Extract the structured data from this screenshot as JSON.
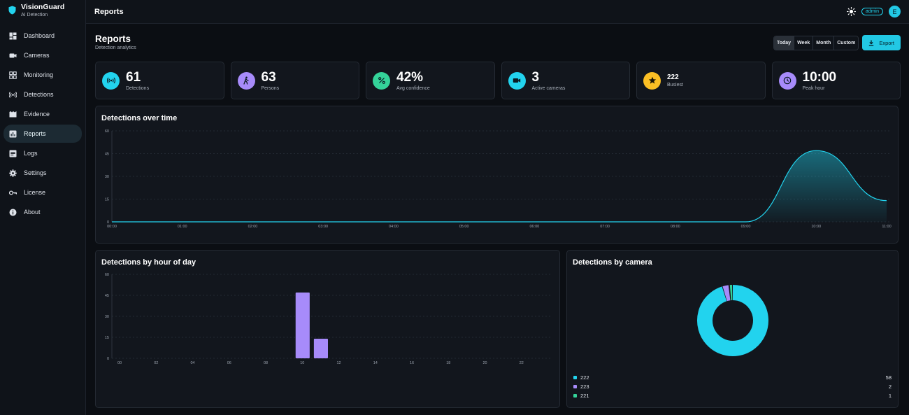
{
  "brand": {
    "name": "VisionGuard",
    "subtitle": "AI Detection"
  },
  "sidebar": {
    "items": [
      {
        "label": "Dashboard",
        "icon": "dashboard-icon"
      },
      {
        "label": "Cameras",
        "icon": "camera-icon"
      },
      {
        "label": "Monitoring",
        "icon": "grid-icon"
      },
      {
        "label": "Detections",
        "icon": "broadcast-icon"
      },
      {
        "label": "Evidence",
        "icon": "film-icon"
      },
      {
        "label": "Reports",
        "icon": "bar-chart-icon",
        "active": true
      },
      {
        "label": "Logs",
        "icon": "document-icon"
      },
      {
        "label": "Settings",
        "icon": "gear-icon"
      },
      {
        "label": "License",
        "icon": "key-icon"
      },
      {
        "label": "About",
        "icon": "info-icon"
      }
    ]
  },
  "topbar": {
    "title": "Reports",
    "role_badge": "admin",
    "avatar_letter": "E",
    "theme_icon": "sun-icon"
  },
  "page": {
    "title": "Reports",
    "subtitle": "Detection analytics"
  },
  "range": {
    "options": [
      "Today",
      "Week",
      "Month",
      "Custom"
    ],
    "selected": "Today"
  },
  "export_label": "Export",
  "stats": [
    {
      "value": "61",
      "label": "Detections",
      "icon": "broadcast-icon",
      "color": "#22d3ee"
    },
    {
      "value": "63",
      "label": "Persons",
      "icon": "person-walking-icon",
      "color": "#a78bfa"
    },
    {
      "value": "42%",
      "label": "Avg confidence",
      "icon": "percent-icon",
      "color": "#34d399"
    },
    {
      "value": "3",
      "label": "Active cameras",
      "icon": "video-icon",
      "color": "#22d3ee"
    },
    {
      "value": "222",
      "label": "Busiest",
      "icon": "star-icon",
      "color": "#fbbf24"
    },
    {
      "value": "10:00",
      "label": "Peak hour",
      "icon": "clock-icon",
      "color": "#a78bfa"
    }
  ],
  "colors": {
    "accent": "#22d3ee",
    "purple": "#a78bfa",
    "green": "#34d399",
    "amber": "#fbbf24"
  },
  "chart_data": [
    {
      "type": "area",
      "title": "Detections over time",
      "x": [
        "00:00",
        "01:00",
        "02:00",
        "03:00",
        "04:00",
        "05:00",
        "06:00",
        "07:00",
        "08:00",
        "09:00",
        "10:00",
        "11:00"
      ],
      "series": [
        {
          "values": [
            0,
            0,
            0,
            0,
            0,
            0,
            0,
            0,
            0,
            0,
            47,
            14
          ]
        }
      ],
      "yticks": [
        0,
        15,
        30,
        45,
        60
      ],
      "ylim": [
        0,
        60
      ],
      "grid": true
    },
    {
      "type": "bar",
      "title": "Detections by hour of day",
      "categories": [
        "00",
        "01",
        "02",
        "03",
        "04",
        "05",
        "06",
        "07",
        "08",
        "09",
        "10",
        "11",
        "12",
        "13",
        "14",
        "15",
        "16",
        "17",
        "18",
        "19",
        "20",
        "21",
        "22",
        "23"
      ],
      "tick_labels": [
        "00",
        "02",
        "04",
        "06",
        "08",
        "10",
        "12",
        "14",
        "16",
        "18",
        "20",
        "22"
      ],
      "values": [
        0,
        0,
        0,
        0,
        0,
        0,
        0,
        0,
        0,
        0,
        47,
        14,
        0,
        0,
        0,
        0,
        0,
        0,
        0,
        0,
        0,
        0,
        0,
        0
      ],
      "yticks": [
        0,
        15,
        30,
        45,
        60
      ],
      "ylim": [
        0,
        60
      ],
      "grid": true
    },
    {
      "type": "pie",
      "title": "Detections by camera",
      "donut": true,
      "labels": [
        "222",
        "223",
        "221"
      ],
      "values": [
        58,
        2,
        1
      ],
      "legend": "bottom"
    }
  ]
}
